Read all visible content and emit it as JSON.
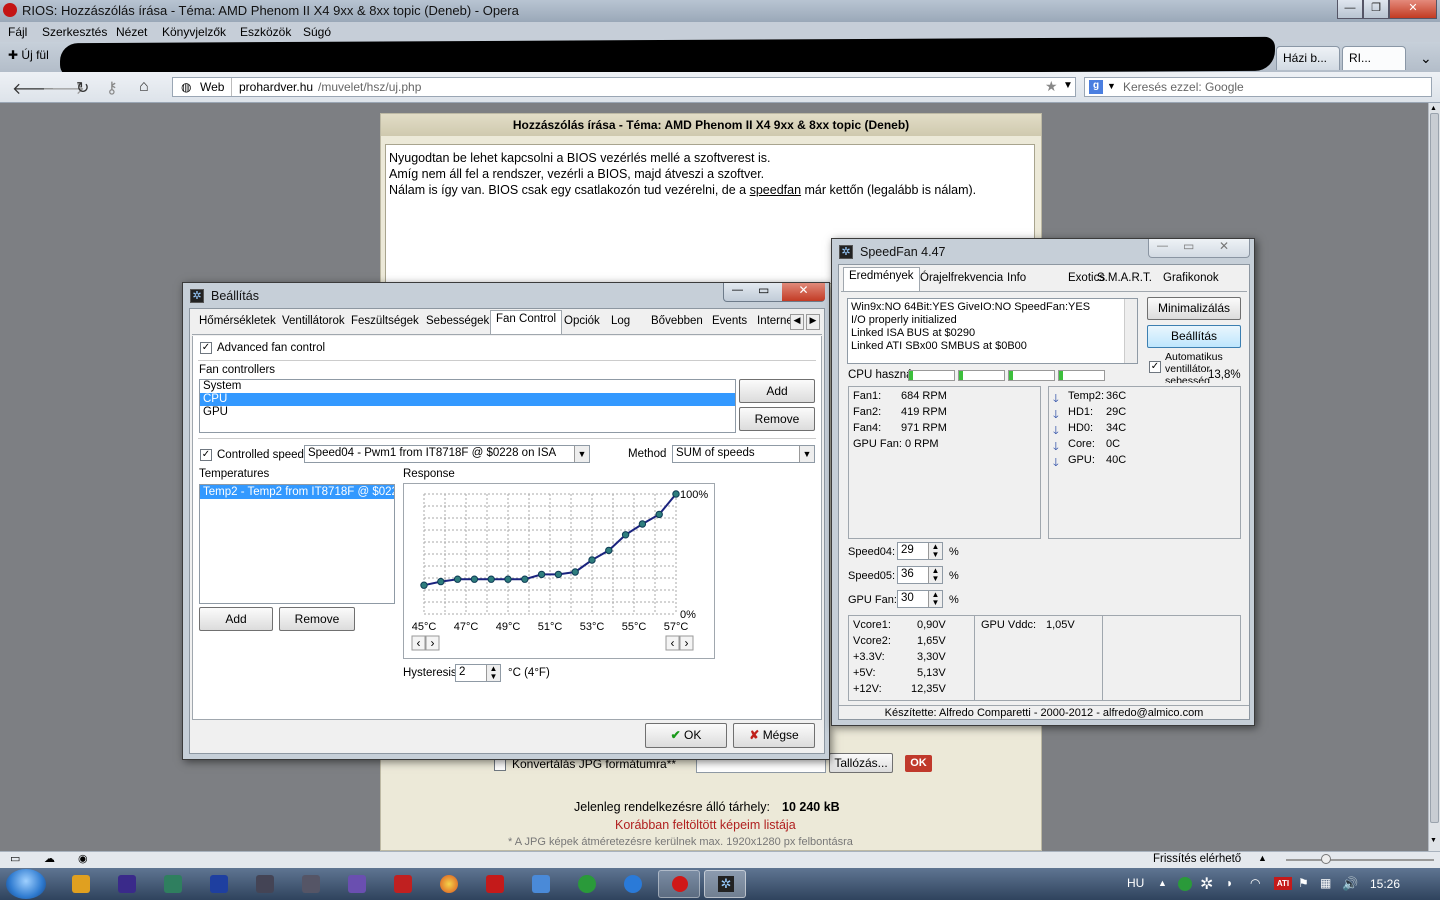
{
  "browser": {
    "title": "RIOS: Hozzászólás írása - Téma: AMD Phenom II X4 9xx & 8xx topic (Deneb) - Opera",
    "menu": [
      "Fájl",
      "Szerkesztés",
      "Nézet",
      "Könyvjelzők",
      "Eszközök",
      "Súgó"
    ],
    "new_tab": "Új fül",
    "tabs": [
      "Házi b...",
      "RI..."
    ],
    "web_label": "Web",
    "url_host": "prohardver.hu",
    "url_path": "/muvelet/hsz/uj.php",
    "search_placeholder": "Keresés ezzel: Google",
    "status_right": "Frissítés elérhető"
  },
  "page": {
    "title": "Hozzászólás írása - Téma: AMD Phenom II X4 9xx & 8xx topic (Deneb)",
    "lines": [
      "Nyugodtan be lehet kapcsolni a BIOS vezérlés mellé a szoftverest is.",
      "Amíg nem áll fel a rendszer, vezérli a BIOS, majd átveszi a szoftver."
    ],
    "line3_a": "Nálam is így van. BIOS csak egy csatlakozón tud vezérelni, de a ",
    "line3_link": "speedfan",
    "line3_b": " már kettőn (legalább is nálam).",
    "convert_label": "Konvertálás JPG formátumra**",
    "browse": "Tallózás...",
    "ok": "OK",
    "storage_label": "Jelenleg rendelkezésre álló tárhely:",
    "storage_value": "10 240 kB",
    "uploaded_link": "Korábban feltöltött képeim listája",
    "jpg_note": "* A JPG képek átméretezésre kerülnek max. 1920x1280 px felbontásra"
  },
  "setup": {
    "title": "Beállítás",
    "tabs": [
      "Hőmérsékletek",
      "Ventillátorok",
      "Feszültségek",
      "Sebességek",
      "Fan Control",
      "Opciók",
      "Log",
      "Bővebben",
      "Events",
      "Interne"
    ],
    "active_tab": "Fan Control",
    "advanced": "Advanced fan control",
    "fan_controllers": "Fan controllers",
    "controllers": [
      "System",
      "CPU",
      "GPU"
    ],
    "selected_controller": "CPU",
    "add": "Add",
    "remove": "Remove",
    "controlled_speed": "Controlled speed",
    "speed_value": "Speed04 - Pwm1 from IT8718F @ $0228 on ISA",
    "method_label": "Method",
    "method_value": "SUM of speeds",
    "temperatures": "Temperatures",
    "temp_item": "Temp2 - Temp2 from IT8718F @ $0228",
    "response": "Response",
    "hysteresis_label": "Hysteresis",
    "hysteresis_value": "2",
    "hysteresis_unit": "°C (4°F)",
    "ok": "OK",
    "cancel": "Mégse"
  },
  "chart_data": {
    "type": "line",
    "title": "",
    "xlabel": "",
    "ylabel": "",
    "x_ticks": [
      "45°C",
      "47°C",
      "49°C",
      "51°C",
      "53°C",
      "55°C",
      "57°C"
    ],
    "y_max_label": "100%",
    "y_min_label": "0%",
    "x": [
      45,
      46,
      47,
      48,
      49,
      50,
      51,
      52,
      53,
      54,
      55,
      56,
      57
    ],
    "series": [
      {
        "values": [
          24,
          27,
          29,
          29,
          29,
          29,
          29,
          33,
          33,
          35,
          45,
          53,
          66,
          75,
          83,
          100
        ]
      }
    ],
    "xlim": [
      45,
      57
    ],
    "ylim": [
      0,
      100
    ]
  },
  "speedfan": {
    "title": "SpeedFan 4.47",
    "tabs": [
      "Eredmények",
      "Órajelfrekvencia",
      "Info",
      "Exotics",
      "S.M.A.R.T.",
      "Grafikonok"
    ],
    "active_tab": "Eredmények",
    "log": [
      "Win9x:NO  64Bit:YES  GiveIO:NO  SpeedFan:YES",
      "I/O properly initialized",
      "Linked ISA BUS at $0290",
      "Linked ATI SBx00 SMBUS at $0B00"
    ],
    "minimize": "Minimalizálás",
    "settings": "Beállítás",
    "auto_label": "Automatikus ventillátor sebesség",
    "cpu_usage_label": "CPU haszná",
    "cpu_usage_value": "13,8%",
    "fans": [
      {
        "name": "Fan1:",
        "value": "684 RPM"
      },
      {
        "name": "Fan2:",
        "value": "419 RPM"
      },
      {
        "name": "Fan4:",
        "value": "971 RPM"
      }
    ],
    "gpu_fan": "GPU Fan: 0 RPM",
    "temps": [
      {
        "name": "Temp2:",
        "value": "36C"
      },
      {
        "name": "HD1:",
        "value": "29C"
      },
      {
        "name": "HD0:",
        "value": "34C"
      },
      {
        "name": "Core:",
        "value": "0C"
      },
      {
        "name": "GPU:",
        "value": "40C"
      }
    ],
    "speeds": [
      {
        "name": "Speed04:",
        "value": "29",
        "unit": "%"
      },
      {
        "name": "Speed05:",
        "value": "36",
        "unit": "%"
      },
      {
        "name": "GPU Fan:",
        "value": "30",
        "unit": "%"
      }
    ],
    "voltages": [
      {
        "name": "Vcore1:",
        "value": "0,90V"
      },
      {
        "name": "Vcore2:",
        "value": "1,65V"
      },
      {
        "name": "+3.3V:",
        "value": "3,30V"
      },
      {
        "name": "+5V:",
        "value": "5,13V"
      },
      {
        "name": "+12V:",
        "value": "12,35V"
      }
    ],
    "gpu_vddc_label": "GPU Vddc:",
    "gpu_vddc_value": "1,05V",
    "footer": "Készítette: Alfredo Comparetti - 2000-2012 - alfredo@almico.com"
  },
  "taskbar": {
    "lang": "HU",
    "clock": "15:26"
  }
}
